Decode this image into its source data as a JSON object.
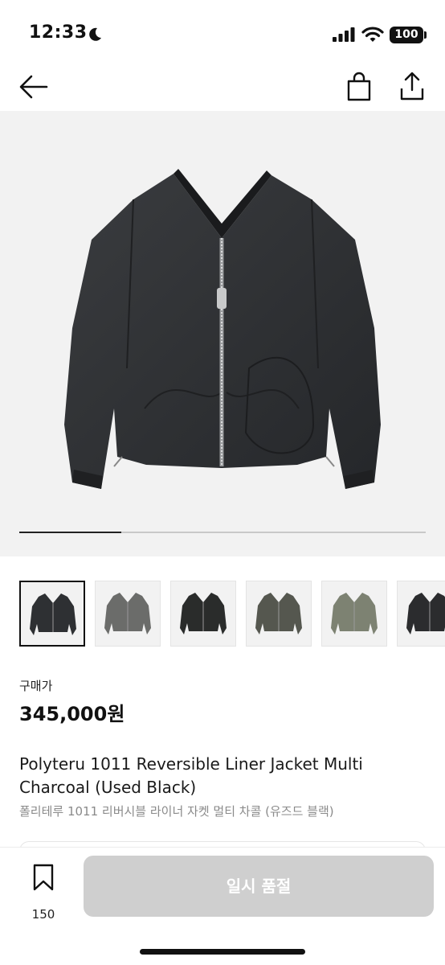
{
  "status_bar": {
    "time": "12:33",
    "battery": "100"
  },
  "nav": {
    "back_icon": "arrow-left-icon",
    "bag_icon": "shopping-bag-icon",
    "share_icon": "share-icon"
  },
  "gallery": {
    "image_count": 6,
    "progress": 0.25,
    "selected_index": 0
  },
  "thumbnails": [
    {
      "colorway": "black",
      "tone": "#2e3033"
    },
    {
      "colorway": "grey",
      "tone": "#6b6c6a"
    },
    {
      "colorway": "black",
      "tone": "#2a2c2b"
    },
    {
      "colorway": "charcoal",
      "tone": "#55574f"
    },
    {
      "colorway": "olive",
      "tone": "#7d8272"
    },
    {
      "colorway": "black",
      "tone": "#2b2c2e"
    }
  ],
  "product": {
    "price_label": "구매가",
    "price": "345,000원",
    "title_en": "Polyteru 1011 Reversible Liner Jacket Multi Charcoal (Used Black)",
    "title_ko": "폴리테루 1011 리버시블 라이너 자켓 멀티 차콜 (유즈드 블랙)"
  },
  "bottom_bar": {
    "bookmark_count": "150",
    "button_label": "일시 품절"
  },
  "colors": {
    "hero_bg": "#f2f2f2",
    "button_disabled": "#cfcfcf",
    "jacket": "#2e3033"
  }
}
